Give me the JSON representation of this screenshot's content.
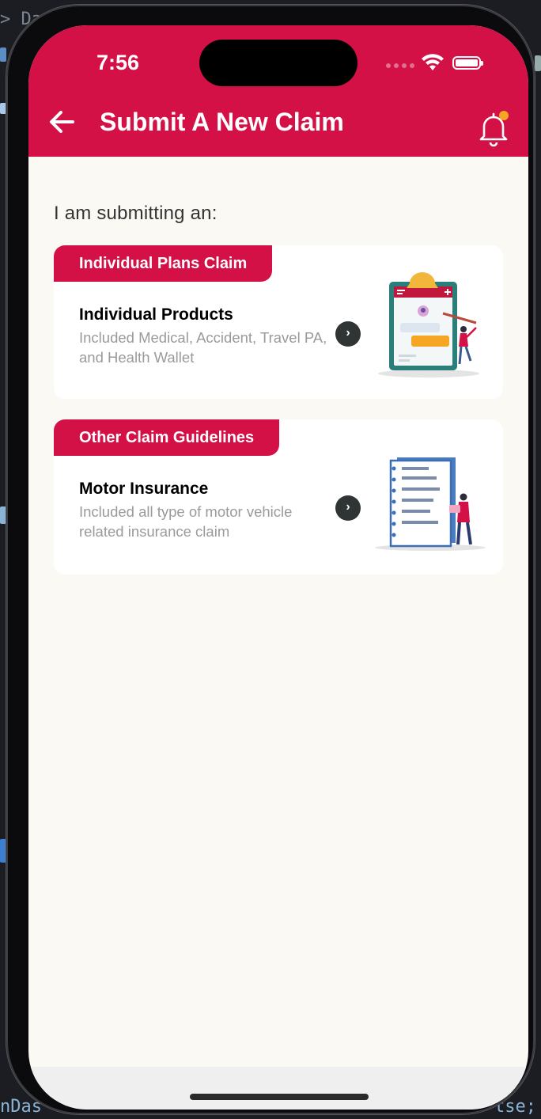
{
  "background": {
    "ide_top_text": "> Da",
    "ide_bottom_left": "nDas",
    "ide_bottom_right": "tse;"
  },
  "status_bar": {
    "time": "7:56"
  },
  "header": {
    "title": "Submit A New Claim",
    "accent_color": "#d31146",
    "notification_dot_color": "#f5a623"
  },
  "main": {
    "prompt": "I am submitting an:",
    "cards": [
      {
        "tag": "Individual Plans Claim",
        "title": "Individual Products",
        "description": "Included Medical, Accident, Travel PA, and Health Wallet",
        "action_icon": "chevron-right-icon",
        "illustration": "clipboard-illustration"
      },
      {
        "tag": "Other Claim Guidelines",
        "title": "Motor Insurance",
        "description": "Included all type of motor vehicle related insurance claim",
        "action_icon": "chevron-right-icon",
        "illustration": "document-illustration"
      }
    ]
  }
}
